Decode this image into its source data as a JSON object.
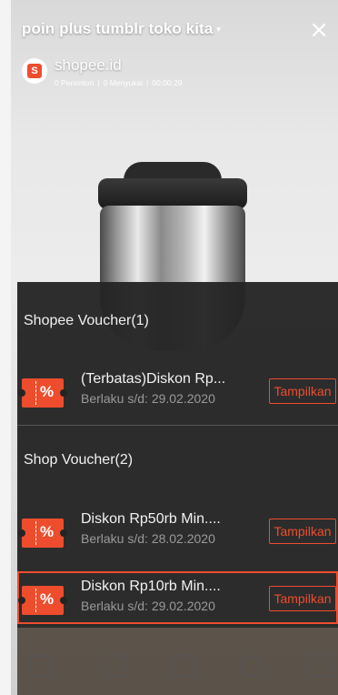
{
  "stream": {
    "title": "poin plus tumblr toko kita",
    "caret": "▾",
    "close_icon": "×",
    "shop_name": "shopee.id",
    "viewers": "0 Penonton",
    "likes": "0 Menyukai",
    "duration": "00:00:29"
  },
  "vouchers": {
    "shopee_section": "Shopee Voucher(1)",
    "shop_section": "Shop Voucher(2)",
    "icon_glyph": "%",
    "button_label": "Tampilkan",
    "items": [
      {
        "title": "(Terbatas)Diskon Rp...",
        "valid": "Berlaku s/d: 29.02.2020"
      },
      {
        "title": "Diskon Rp50rb Min....",
        "valid": "Berlaku s/d: 28.02.2020"
      },
      {
        "title": "Diskon Rp10rb Min....",
        "valid": "Berlaku s/d: 29.02.2020"
      }
    ]
  },
  "colors": {
    "accent": "#ee4d2d",
    "panel": "#242424"
  }
}
